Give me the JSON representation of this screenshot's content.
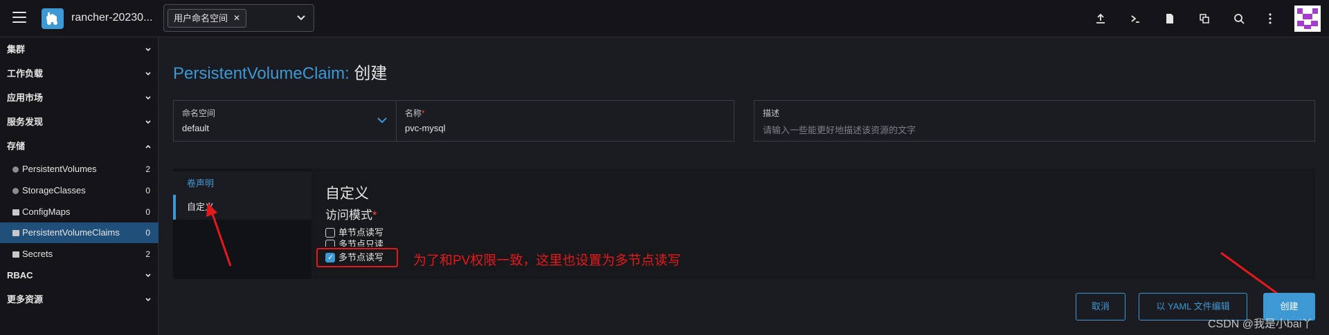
{
  "header": {
    "cluster_name": "rancher-20230...",
    "namespace_chip": "用户命名空间",
    "icons": [
      "upload-icon",
      "terminal-icon",
      "file-icon",
      "copy-icon",
      "search-icon",
      "more-icon"
    ]
  },
  "sidebar": {
    "groups": [
      {
        "label": "集群"
      },
      {
        "label": "工作负载"
      },
      {
        "label": "应用市场"
      },
      {
        "label": "服务发现"
      },
      {
        "label": "存储"
      },
      {
        "label": "RBAC"
      },
      {
        "label": "更多资源"
      }
    ],
    "storage_items": [
      {
        "label": "PersistentVolumes",
        "count": "2",
        "icon": "circle"
      },
      {
        "label": "StorageClasses",
        "count": "0",
        "icon": "circle"
      },
      {
        "label": "ConfigMaps",
        "count": "0",
        "icon": "folder"
      },
      {
        "label": "PersistentVolumeClaims",
        "count": "0",
        "icon": "folder"
      },
      {
        "label": "Secrets",
        "count": "2",
        "icon": "folder"
      }
    ]
  },
  "page": {
    "title_resource": "PersistentVolumeClaim:",
    "title_action": "创建"
  },
  "form": {
    "namespace_label": "命名空间",
    "namespace_value": "default",
    "name_label": "名称",
    "name_required": "*",
    "name_value": "pvc-mysql",
    "description_label": "描述",
    "description_placeholder": "请输入一些能更好地描述该资源的文字"
  },
  "tabs": {
    "first": "卷声明",
    "second": "自定义"
  },
  "section": {
    "title": "自定义",
    "subtitle": "访问模式",
    "required": "*",
    "options": [
      {
        "label": "单节点读写",
        "checked": false
      },
      {
        "label": "多节点只读",
        "checked": false
      },
      {
        "label": "多节点读写",
        "checked": true
      }
    ]
  },
  "annotation": "为了和PV权限一致，这里也设置为多节点读写",
  "buttons": {
    "cancel": "取消",
    "yaml": "以 YAML 文件编辑",
    "create": "创建"
  },
  "watermark": "CSDN @我是小bai丫",
  "colors": {
    "accent": "#3d98d3",
    "annotation_red": "#e5191b",
    "active_nav": "#20507a"
  }
}
